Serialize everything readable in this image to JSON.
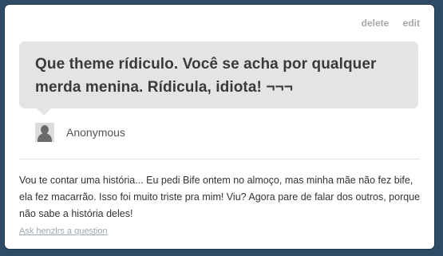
{
  "actions": {
    "delete_label": "delete",
    "edit_label": "edit"
  },
  "question": {
    "text": "Que theme rídiculo. Você se acha por qualquer merda menina. Rídicula, idiota! ¬¬¬"
  },
  "asker": {
    "name": "Anonymous",
    "avatar_icon": "anonymous-user-icon"
  },
  "answer": {
    "text": "Vou te contar uma história... Eu pedi Bife ontem no almoço, mas minha mãe não fez bife, ela fez macarrão. Isso foi muito triste pra mim! Viu? Agora pare de falar dos outros, porque não sabe a história deles!"
  },
  "footer": {
    "ask_link": "Ask henzlrs a question"
  },
  "colors": {
    "page_background": "#2f4a64",
    "bubble": "#e2e4e6"
  }
}
